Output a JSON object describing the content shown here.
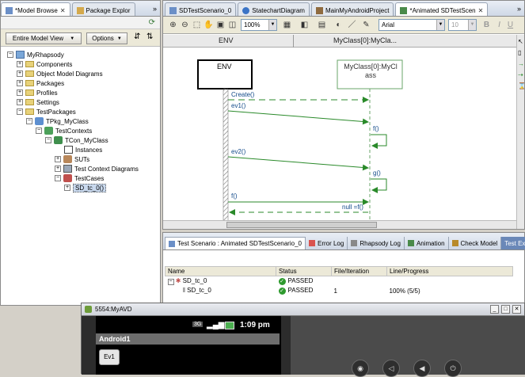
{
  "left_panel": {
    "tabs": [
      "*Model Browse",
      "Package Explor"
    ],
    "view_dropdown": "Entire Model View",
    "options_button": "Options",
    "tree": [
      {
        "label": "MyRhapsody",
        "depth": 0
      },
      {
        "label": "Components",
        "depth": 1
      },
      {
        "label": "Object Model Diagrams",
        "depth": 1
      },
      {
        "label": "Packages",
        "depth": 1
      },
      {
        "label": "Profiles",
        "depth": 1
      },
      {
        "label": "Settings",
        "depth": 1
      },
      {
        "label": "TestPackages",
        "depth": 1
      },
      {
        "label": "TPkg_MyClass",
        "depth": 2
      },
      {
        "label": "TestContexts",
        "depth": 3
      },
      {
        "label": "TCon_MyClass",
        "depth": 4
      },
      {
        "label": "Instances",
        "depth": 5
      },
      {
        "label": "SUTs",
        "depth": 5
      },
      {
        "label": "Test Context Diagrams",
        "depth": 5
      },
      {
        "label": "TestCases",
        "depth": 5
      },
      {
        "label": "SD_tc_0()",
        "depth": 6
      }
    ]
  },
  "editor": {
    "tabs": [
      "SDTestScenario_0",
      "StatechartDiagram",
      "MainMyAndroidProject",
      "*Animated SDTestScen"
    ],
    "zoom": "100%",
    "font": "Arial",
    "font_size": "10",
    "lanes": {
      "env": "ENV",
      "myclass": "MyClass[0]:MyCla..."
    },
    "env_box": "ENV",
    "class_box": "MyClass[0]:MyCl ass",
    "messages": {
      "create": "Create()",
      "ev1": "ev1()",
      "f1": "f()",
      "ev2": "ev2()",
      "g": "g()",
      "f2": "f()",
      "null_ret": "null =f()"
    }
  },
  "bottom": {
    "tabs": [
      "Test Scenario : Animated SDTestScenario_0",
      "Error Log",
      "Rhapsody Log",
      "Animation",
      "Check Model",
      "Test Executi"
    ],
    "columns": [
      "Name",
      "Status",
      "File/Iteration",
      "Line/Progress"
    ],
    "rows": [
      {
        "name": "SD_tc_0",
        "status": "PASSED",
        "file": "",
        "line": ""
      },
      {
        "name": "SD_tc_0",
        "status": "PASSED",
        "file": "1",
        "line": "100% (5/5)"
      }
    ]
  },
  "emulator": {
    "title": "5554:MyAVD",
    "time": "1:09 pm",
    "app_title": "Android1",
    "button_label": "Ev1"
  }
}
